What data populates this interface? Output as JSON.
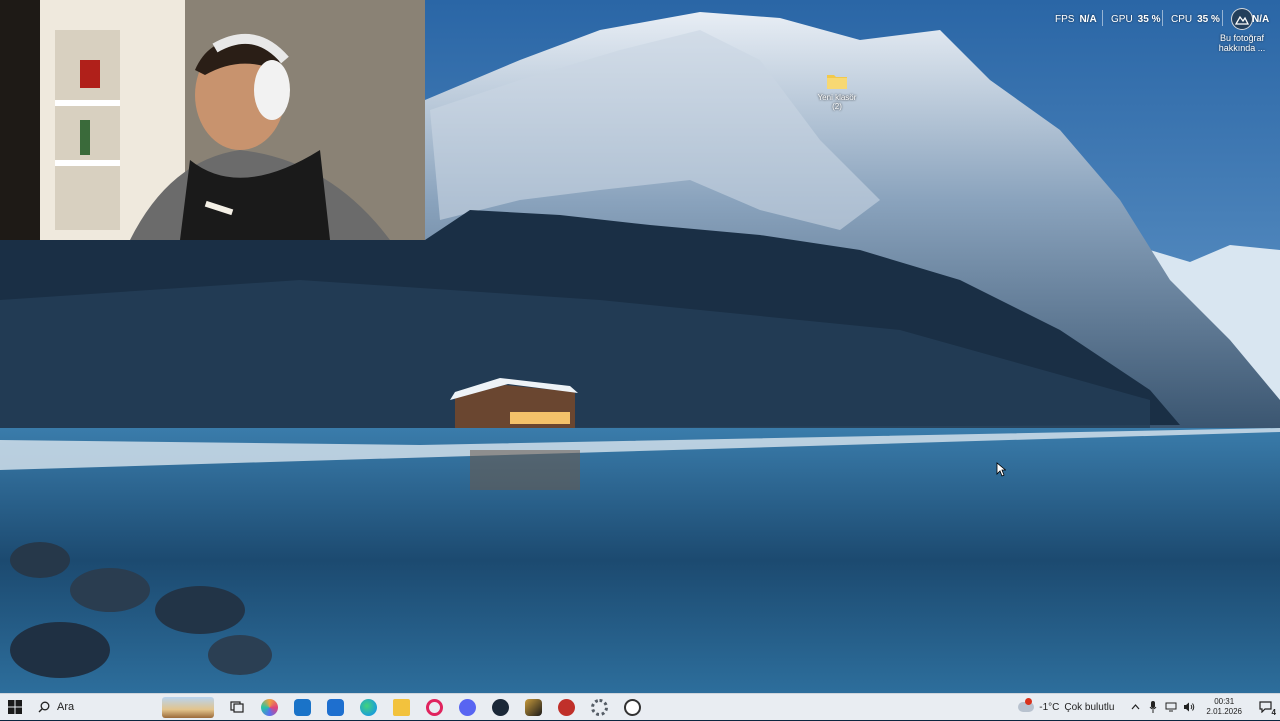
{
  "overlay": {
    "fps": {
      "label": "FPS",
      "value": "N/A"
    },
    "gpu": {
      "label": "GPU",
      "value": "35 %"
    },
    "cpu": {
      "label": "CPU",
      "value": "35 %"
    },
    "extra": {
      "value": "N/A"
    }
  },
  "desktop": {
    "about_photo_label_line1": "Bu fotoğraf",
    "about_photo_label_line2": "hakkında ...",
    "folder_label_line1": "Yeni klasör",
    "folder_label_line2": "(2)"
  },
  "taskbar": {
    "search_placeholder": "Ara",
    "apps": [
      {
        "name": "copilot-icon",
        "color": "#f0a040"
      },
      {
        "name": "outlook-icon",
        "color": "#1a73c8"
      },
      {
        "name": "store-icon",
        "color": "#1e6fcf"
      },
      {
        "name": "edge-icon",
        "color": "#1b9fd8"
      },
      {
        "name": "file-explorer-icon",
        "color": "#f2c23d"
      },
      {
        "name": "opera-gx-icon",
        "color": "#e0245e"
      },
      {
        "name": "discord-icon",
        "color": "#5865f2"
      },
      {
        "name": "steam-icon",
        "color": "#1b2838"
      },
      {
        "name": "league-icon",
        "color": "#c89b3c"
      },
      {
        "name": "app-red-icon",
        "color": "#c0302a"
      },
      {
        "name": "settings-icon",
        "color": "#555d66"
      },
      {
        "name": "obs-icon",
        "color": "#333333"
      }
    ],
    "weather": {
      "temp": "-1°C",
      "text": "Çok bulutlu"
    },
    "clock": {
      "time": "00:31",
      "date": "2.01.2026"
    },
    "notification_count": "4"
  }
}
